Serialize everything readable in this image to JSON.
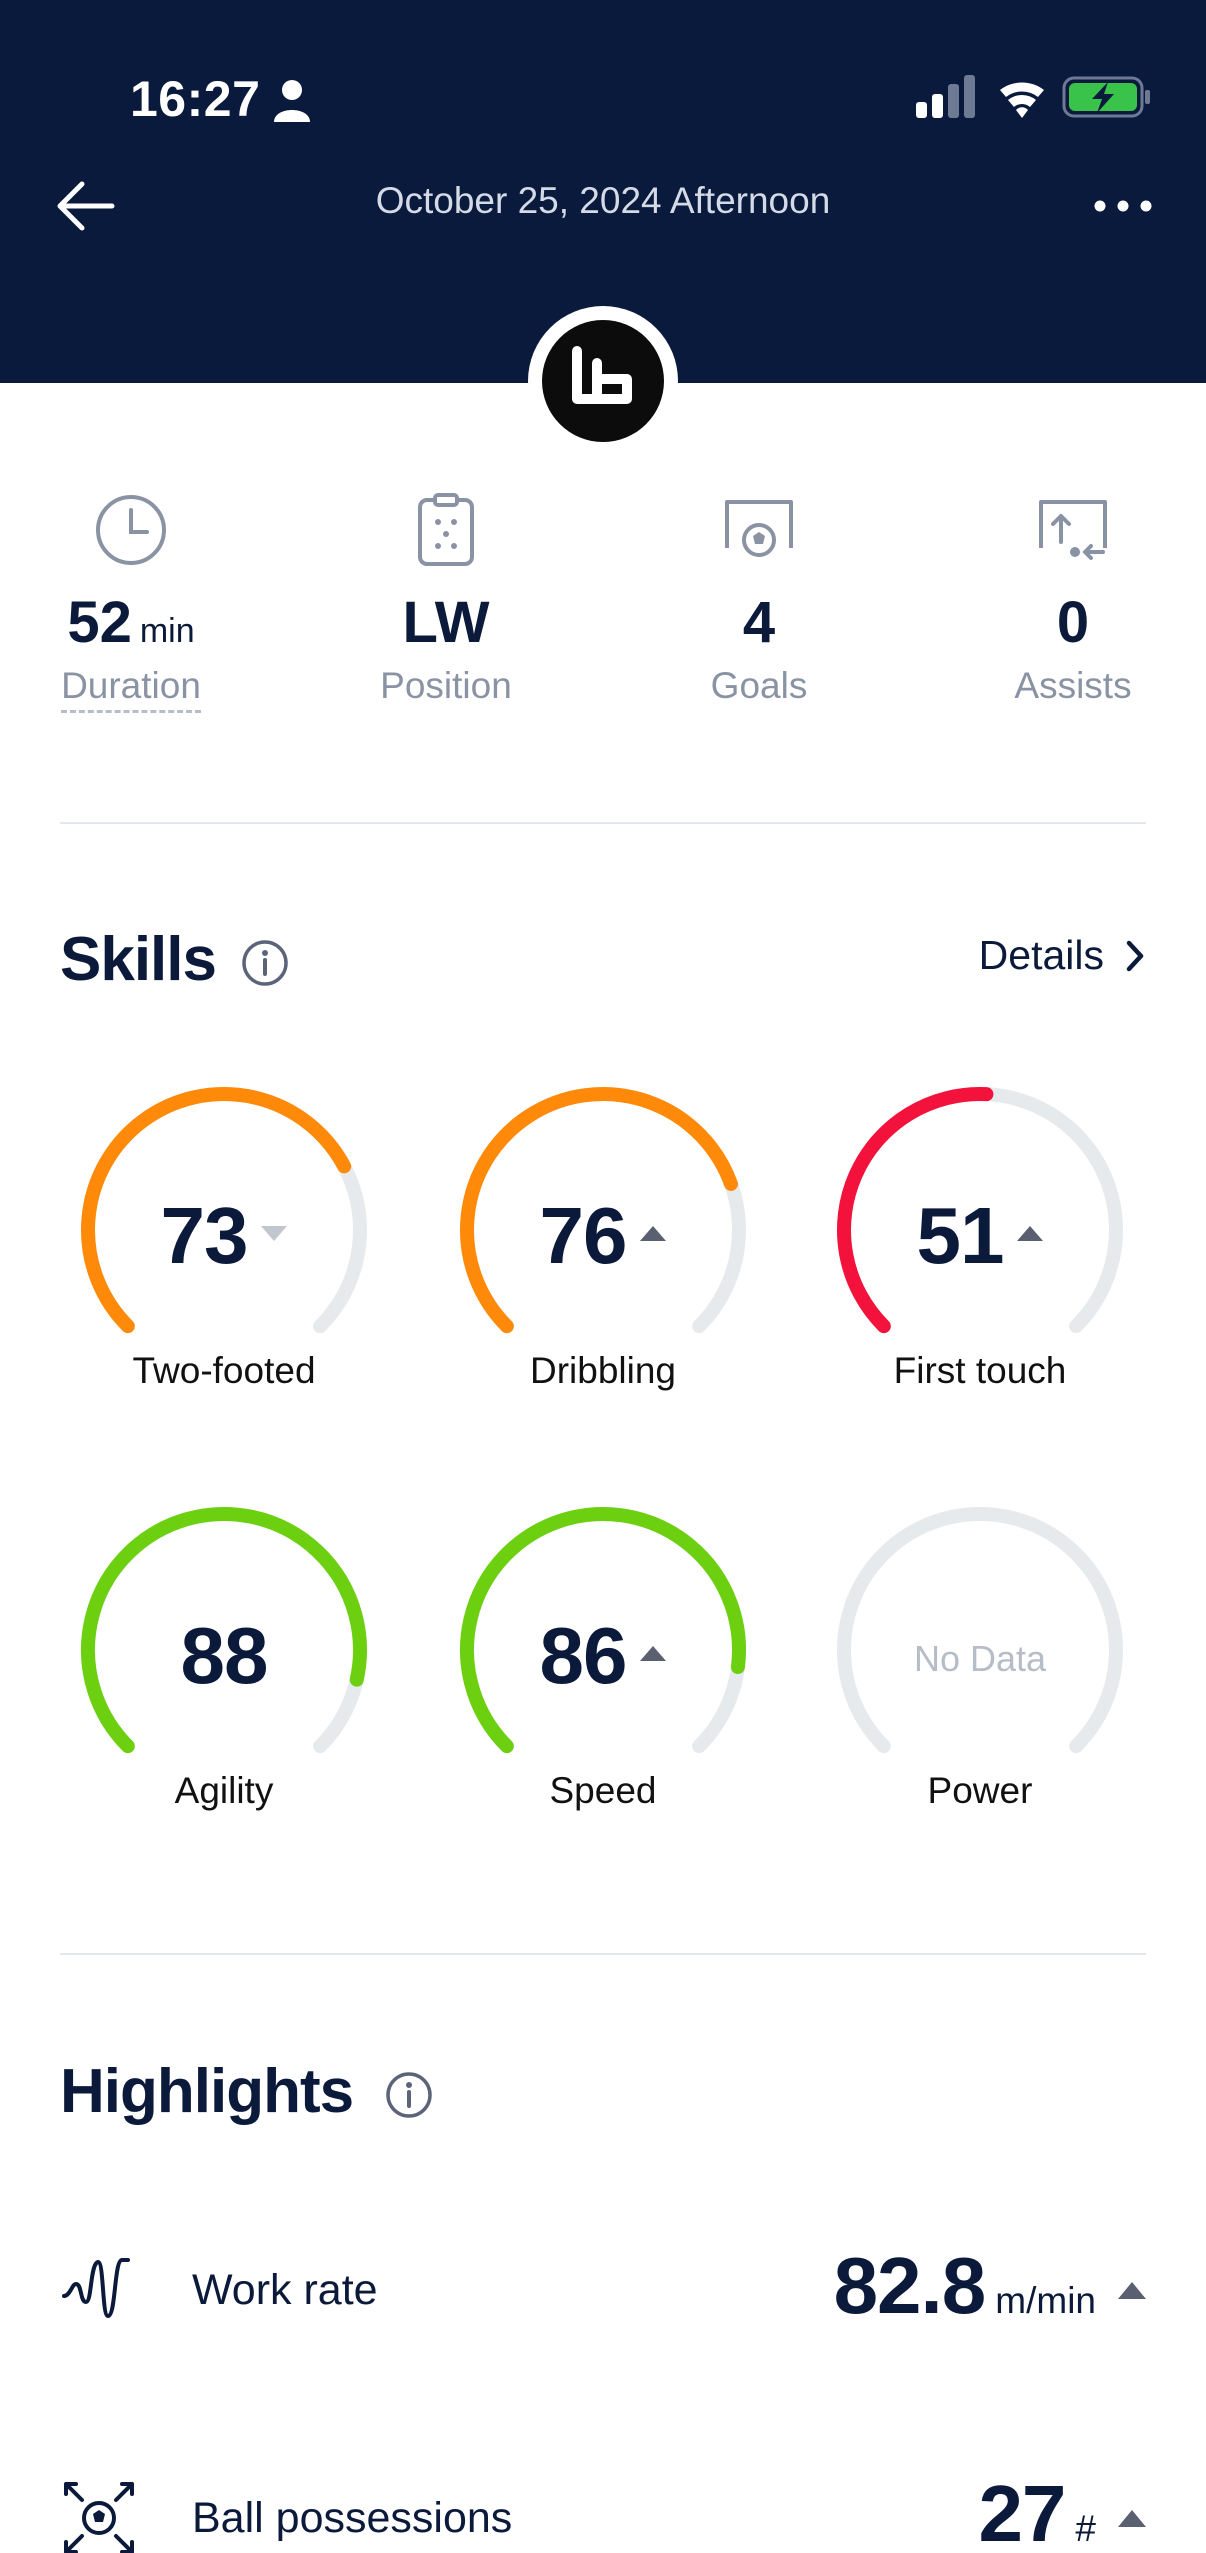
{
  "status_bar": {
    "time": "16:27"
  },
  "nav": {
    "title": "October 25, 2024 Afternoon"
  },
  "stats": [
    {
      "value": "52",
      "unit": "min",
      "label": "Duration",
      "icon": "clock-icon"
    },
    {
      "value": "LW",
      "unit": "",
      "label": "Position",
      "icon": "clipboard-icon"
    },
    {
      "value": "4",
      "unit": "",
      "label": "Goals",
      "icon": "goal-icon"
    },
    {
      "value": "0",
      "unit": "",
      "label": "Assists",
      "icon": "assist-icon"
    }
  ],
  "skills": {
    "title": "Skills",
    "details_label": "Details",
    "items": [
      {
        "label": "Two-footed",
        "value": 73,
        "trend": "down",
        "color": "#ff8a0a"
      },
      {
        "label": "Dribbling",
        "value": 76,
        "trend": "up",
        "color": "#ff8a0a"
      },
      {
        "label": "First touch",
        "value": 51,
        "trend": "up",
        "color": "#f2123c"
      },
      {
        "label": "Agility",
        "value": 88,
        "trend": "none",
        "color": "#6cd011"
      },
      {
        "label": "Speed",
        "value": 86,
        "trend": "up",
        "color": "#6cd011"
      },
      {
        "label": "Power",
        "value": null,
        "no_data_text": "No Data",
        "trend": "none",
        "color": "#e6eaed"
      }
    ]
  },
  "highlights": {
    "title": "Highlights",
    "items": [
      {
        "label": "Work rate",
        "value": "82.8",
        "unit": "m/min",
        "trend": "up",
        "icon": "work-rate-icon"
      },
      {
        "label": "Ball possessions",
        "value": "27",
        "unit": "#",
        "trend": "up",
        "icon": "ball-possession-icon"
      }
    ]
  },
  "colors": {
    "header_bg": "#0a1a3c",
    "track": "#e6eaed",
    "text_dark": "#0b1a3b",
    "text_muted": "#8a93a4"
  }
}
